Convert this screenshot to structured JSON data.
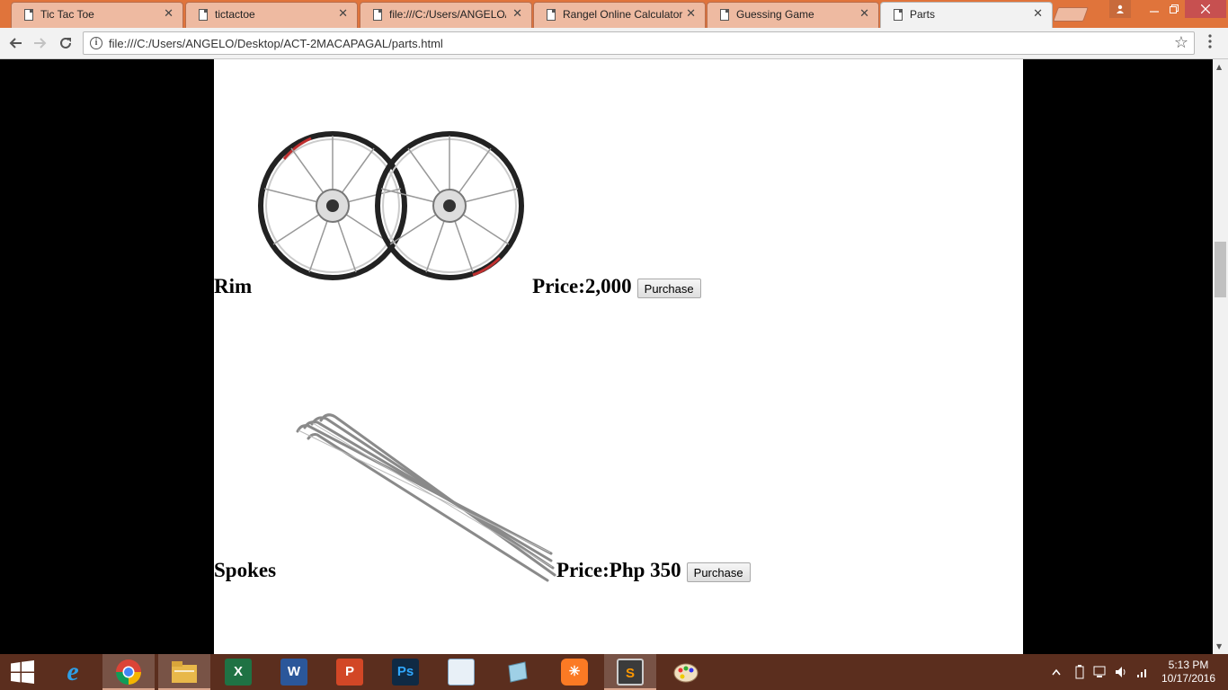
{
  "browser": {
    "tabs": [
      {
        "title": "Tic Tac Toe",
        "active": false
      },
      {
        "title": "tictactoe",
        "active": false
      },
      {
        "title": "file:///C:/Users/ANGELO/",
        "active": false
      },
      {
        "title": "Rangel Online Calculator",
        "active": false
      },
      {
        "title": "Guessing Game",
        "active": false
      },
      {
        "title": "Parts",
        "active": true
      }
    ],
    "tab_close_glyph": "✕",
    "url": "file:///C:/Users/ANGELO/Desktop/ACT-2MACAPAGAL/parts.html",
    "icons": [
      "back-icon",
      "forward-icon",
      "reload-icon",
      "info-icon",
      "bookmark-star-icon",
      "menu-icon"
    ]
  },
  "products": [
    {
      "name": "Rim",
      "price": "Price:2,000",
      "button": "Purchase",
      "image": "bicycle-rims-image"
    },
    {
      "name": "Spokes",
      "price": "Price:Php 350",
      "button": "Purchase",
      "image": "bicycle-spokes-image"
    }
  ],
  "colors": {
    "tab_strip": "#e0743b",
    "page_background": "#ffffff",
    "side_background": "#000000",
    "taskbar": "#5b2e1e"
  },
  "taskbar": {
    "apps": [
      {
        "name": "internet-explorer-icon",
        "label": "e",
        "active": false
      },
      {
        "name": "chrome-icon",
        "label": "",
        "active": true
      },
      {
        "name": "file-explorer-icon",
        "label": "",
        "active": true
      },
      {
        "name": "excel-icon",
        "label": "X",
        "active": false
      },
      {
        "name": "word-icon",
        "label": "W",
        "active": false
      },
      {
        "name": "powerpoint-icon",
        "label": "P",
        "active": false
      },
      {
        "name": "photoshop-icon",
        "label": "Ps",
        "active": false
      },
      {
        "name": "mysql-installer-icon",
        "label": "",
        "active": false
      },
      {
        "name": "notepad-icon",
        "label": "",
        "active": false
      },
      {
        "name": "xampp-icon",
        "label": "",
        "active": false
      },
      {
        "name": "sublime-text-icon",
        "label": "S",
        "active": true
      },
      {
        "name": "paint-icon",
        "label": "",
        "active": false
      }
    ],
    "time": "5:13 PM",
    "date": "10/17/2016"
  }
}
